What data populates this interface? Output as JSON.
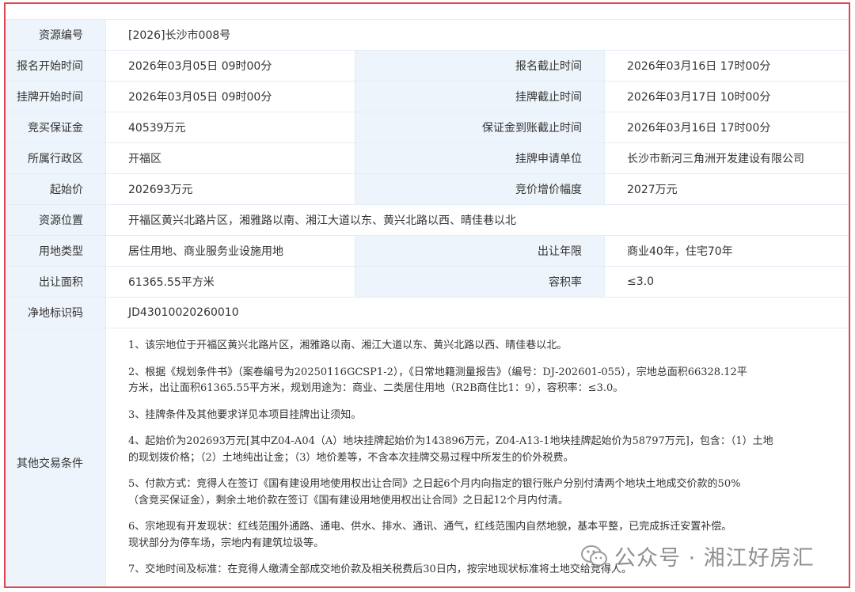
{
  "rows": {
    "resource_no": {
      "label": "资源编号",
      "value": "[2026]长沙市008号"
    },
    "reg_start": {
      "label": "报名开始时间",
      "value": "2026年03月05日 09时00分"
    },
    "reg_end": {
      "label": "报名截止时间",
      "value": "2026年03月16日 17时00分"
    },
    "list_start": {
      "label": "挂牌开始时间",
      "value": "2026年03月05日 09时00分"
    },
    "list_end": {
      "label": "挂牌截止时间",
      "value": "2026年03月17日 10时00分"
    },
    "deposit": {
      "label": "竞买保证金",
      "value": "40539万元"
    },
    "deposit_deadline": {
      "label": "保证金到账截止时间",
      "value": "2026年03月16日 17时00分"
    },
    "district": {
      "label": "所属行政区",
      "value": "开福区"
    },
    "applicant": {
      "label": "挂牌申请单位",
      "value": "长沙市新河三角洲开发建设有限公司"
    },
    "start_price": {
      "label": "起始价",
      "value": "202693万元"
    },
    "increment": {
      "label": "竞价增价幅度",
      "value": "2027万元"
    },
    "location": {
      "label": "资源位置",
      "value": "开福区黄兴北路片区，湘雅路以南、湘江大道以东、黄兴北路以西、晴佳巷以北"
    },
    "land_type": {
      "label": "用地类型",
      "value": "居住用地、商业服务业设施用地"
    },
    "term": {
      "label": "出让年限",
      "value": "商业40年，住宅70年"
    },
    "area": {
      "label": "出让面积",
      "value": "61365.55平方米"
    },
    "far": {
      "label": "容积率",
      "value": "≤3.0"
    },
    "land_id": {
      "label": "净地标识码",
      "value": "JD43010020260010"
    },
    "other_label": "其他交易条件"
  },
  "conditions": [
    "1、该宗地位于开福区黄兴北路片区，湘雅路以南、湘江大道以东、黄兴北路以西、晴佳巷以北。",
    "2、根据《规划条件书》（案卷编号为20250116GCSP1-2），《日常地籍测量报告》（编号：DJ-202601-055），宗地总面积66328.12平\n方米，出让面积61365.55平方米，规划用途为：商业、二类居住用地（R2B商住比1：9），容积率：≤3.0。",
    "3、挂牌条件及其他要求详见本项目挂牌出让须知。",
    "4、起始价为202693万元[其中Z04-A04（A）地块挂牌起始价为143896万元，Z04-A13-1地块挂牌起始价为58797万元]，包含：（1）土地\n的现划拨价格；（2）土地纯出让金；（3）地价差等，不含本次挂牌交易过程中所发生的价外税费。",
    "5、付款方式：竞得人在签订《国有建设用地使用权出让合同》之日起6个月内向指定的银行账户分别付清两个地块土地成交价款的50%\n（含竞买保证金），剩余土地价款在签订《国有建设用地使用权出让合同》之日起12个月内付清。",
    "6、宗地现有开发现状：红线范围外通路、通电、供水、排水、通讯、通气，红线范围内自然地貌，基本平整，已完成拆迁安置补偿。\n现状部分为停车场，宗地内有建筑垃圾等。",
    "7、交地时间及标准：在竞得人缴清全部成交地价款及相关税费后30日内，按宗地现状标准将土地交给竞得人。"
  ],
  "watermark": {
    "text": "公众号 · 湘江好房汇",
    "icon": "wechat-icon"
  }
}
